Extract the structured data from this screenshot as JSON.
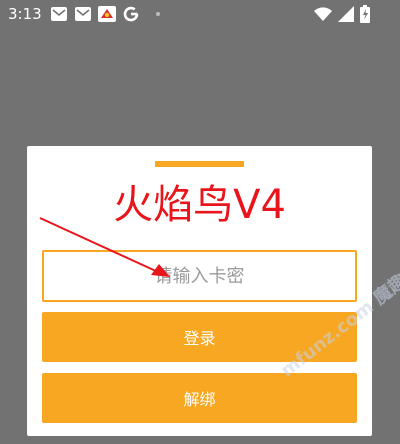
{
  "status_bar": {
    "time": "3:13",
    "left_icons": [
      "mail-icon",
      "mail-icon",
      "bird-app-icon",
      "google-icon"
    ],
    "right_icons": [
      "wifi-icon",
      "signal-icon",
      "battery-charging-icon"
    ]
  },
  "dialog": {
    "title": "火焰鸟V4",
    "card_input": {
      "value": "",
      "placeholder": "请输入卡密"
    },
    "login_label": "登录",
    "unbind_label": "解绑"
  },
  "watermark": "mfunz.com 魔趣",
  "colors": {
    "accent": "#f7a722",
    "title": "#e8161c",
    "backdrop": "#727272"
  }
}
